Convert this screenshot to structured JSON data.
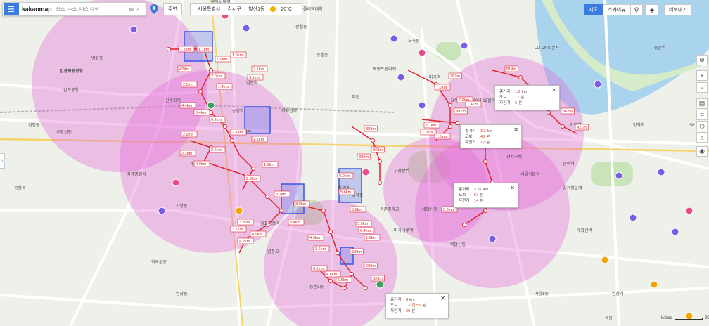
{
  "search": {
    "logo": "kakaomap",
    "placeholder": "장소, 주소, 버스 검색"
  },
  "toolbar": {
    "home_label": "주변",
    "breadcrumbs": [
      "서울특별시",
      "강서구",
      "발산1동"
    ],
    "weather": "20°C"
  },
  "right_toolbar": {
    "map_label": "지도",
    "skyview_label": "스카이뷰",
    "share_label": "네보내기"
  },
  "map_labels": [
    "김포국제공항",
    "김포공항",
    "공항동",
    "방화동",
    "개화산",
    "신방화역",
    "송정역",
    "마곡역",
    "발산역",
    "우장산역",
    "화곡역",
    "까치산역",
    "강서구청",
    "가양역",
    "증미역",
    "등촌역",
    "염창역",
    "목동",
    "신정동",
    "부천",
    "오곡동",
    "LG CNS 본사",
    "서울식물원",
    "가양동",
    "등촌동",
    "화곡동",
    "신월동",
    "한국폴리텍대학",
    "김포공항역",
    "마곡나루역",
    "양천향교역",
    "방화역",
    "개화산역",
    "내발산동",
    "외발산동",
    "우장산동",
    "화곡본동",
    "염창동",
    "등촌3동",
    "가양1동",
    "공항시장역",
    "강서구청 (2026년 12월 예정)",
    "SK 주유소",
    "플러스마트",
    "염창고",
    "목동트윈타워",
    "등촌중학교",
    "마곡엠밸리",
    "발산초등학교"
  ],
  "distance_labels": [
    "1.8km",
    "1.7km",
    "1.9km",
    "2.5km",
    "4.4km",
    "5.4km",
    "6.2km",
    "2.9km",
    "2.2km",
    "2.6km",
    "2.4km",
    "1.1km",
    "1.3km",
    "2.8km",
    "3.2km",
    "3.0km",
    "3.4km",
    "3.8km",
    "3.7km",
    "4.2km",
    "4.5km",
    "4.3km",
    "3.6km",
    "4.1km",
    "4.8km",
    "6.5km",
    "6.0km",
    "5.6km",
    "5.8km",
    "5.5km",
    "6.4km",
    "7.0km",
    "7.2km",
    "7.4km",
    "7.7km",
    "7.9km",
    "1.5km",
    "1.0km",
    "2.1km",
    "3.1km",
    "3.3km",
    "997m",
    "814m",
    "862m",
    "421m",
    "358m",
    "368m",
    "386m",
    "362m",
    "598m",
    "680m",
    "620m",
    "424m",
    "4.0km",
    "2.0km",
    "1.4km",
    "1.6km"
  ],
  "popups": [
    {
      "rows": [
        {
          "k": "총거리",
          "v": "1.2",
          "u": "km"
        },
        {
          "k": "도보",
          "v": "17",
          "u": "분"
        },
        {
          "k": "자전거",
          "v": "6",
          "u": "분"
        }
      ]
    },
    {
      "rows": [
        {
          "k": "총거리",
          "v": "3.3",
          "u": "km"
        },
        {
          "k": "도보",
          "v": "48",
          "u": "분"
        },
        {
          "k": "자전거",
          "v": "12",
          "u": "분"
        }
      ]
    },
    {
      "rows": [
        {
          "k": "총거리",
          "v": "3.87",
          "u": "km"
        },
        {
          "k": "도보",
          "v": "57",
          "u": "분"
        },
        {
          "k": "자전거",
          "v": "14",
          "u": "분"
        }
      ]
    },
    {
      "rows": [
        {
          "k": "총거리",
          "v": "8",
          "u": "km"
        },
        {
          "k": "도보",
          "v": "1시간 55",
          "u": "분"
        },
        {
          "k": "자전거",
          "v": "30",
          "u": "분"
        }
      ]
    }
  ],
  "scale": {
    "left": "kakao",
    "right": "200m"
  },
  "colors": {
    "accent": "#3a7be0",
    "circle_fill": "#e565d8",
    "route_line": "#e2242f",
    "road": "#ffffff",
    "park": "#c8e4b8",
    "water": "#aad4ee"
  }
}
